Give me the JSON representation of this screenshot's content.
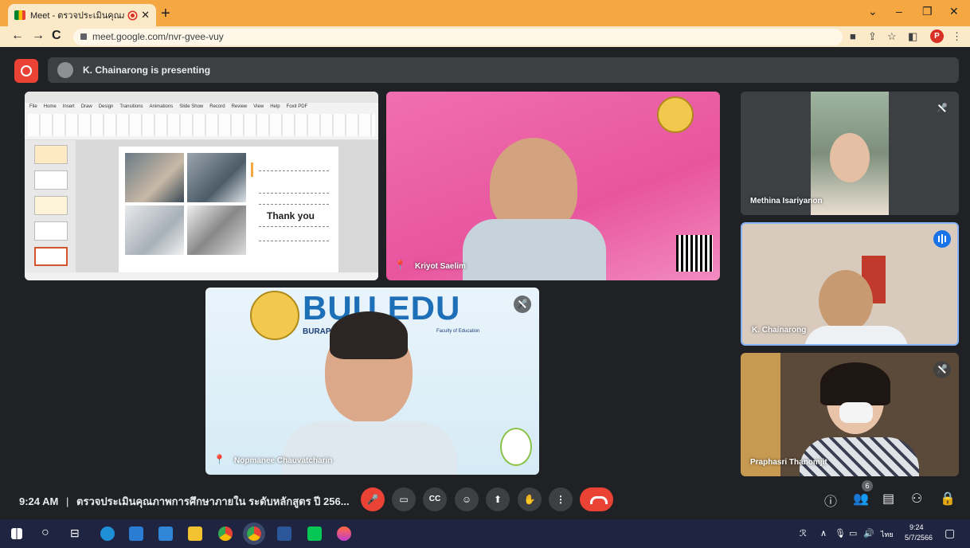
{
  "browser": {
    "tab_title": "Meet - ตรวจประเมินคุณภาพการ",
    "new_tab": "+",
    "url": "meet.google.com/nvr-gvee-vuy",
    "profile_initial": "P",
    "window_controls": [
      "⌄",
      "–",
      "❐",
      "✕"
    ],
    "nav": [
      "←",
      "→",
      "C"
    ]
  },
  "meet": {
    "presenting_text": "K. Chainarong is presenting",
    "slide": {
      "menu": [
        "File",
        "Home",
        "Insert",
        "Draw",
        "Design",
        "Transitions",
        "Animations",
        "Slide Show",
        "Record",
        "Review",
        "View",
        "Help",
        "Foxit PDF"
      ],
      "thank_you": "Thank you"
    },
    "participants": [
      {
        "name": "Kriyot Saelim"
      },
      {
        "name": "Methina Isariyanon"
      },
      {
        "name": "K. Chainarong"
      },
      {
        "name": "Nopmanee Chauvatcharin"
      },
      {
        "name": "Praphasri Thanomjit"
      }
    ],
    "edu_banner": "BUU EDU",
    "edu_sub": "BURAPHA",
    "edu_caption": "Faculty of Education",
    "bottom": {
      "time": "9:24 AM",
      "separator": "|",
      "meeting_title": "ตรวจประเมินคุณภาพการศึกษาภายใน ระดับหลักสูตร ปี 256...",
      "people_count": "6"
    }
  },
  "taskbar": {
    "clock_time": "9:24",
    "clock_date": "5/7/2566",
    "lang": "ไทย"
  },
  "colors": {
    "tab_bar": "#f5a742",
    "meet_bg": "#202124",
    "red": "#ea4335",
    "blue": "#1a73e8",
    "taskbar": "#1f2540"
  }
}
